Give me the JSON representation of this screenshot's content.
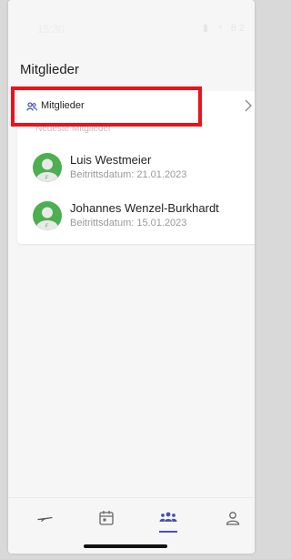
{
  "statusbar": {
    "time": "15:30",
    "icons": "▮ ◔ 82"
  },
  "page": {
    "title": "Mitglieder"
  },
  "card": {
    "header_label": "Mitglieder",
    "subheader": "Neueste Mitglieder",
    "members": [
      {
        "name": "Luis Westmeier",
        "date": "Beitrittsdatum: 21.01.2023"
      },
      {
        "name": "Johannes Wenzel-Burkhardt",
        "date": "Beitrittsdatum: 15.01.2023"
      }
    ]
  },
  "colors": {
    "accent": "#4b50b4",
    "highlight": "#e8141b",
    "avatar": "#4caf50"
  },
  "nav": {
    "items": [
      {
        "icon": "plane-icon"
      },
      {
        "icon": "calendar-icon"
      },
      {
        "icon": "group-icon",
        "active": true
      },
      {
        "icon": "person-icon"
      }
    ]
  }
}
